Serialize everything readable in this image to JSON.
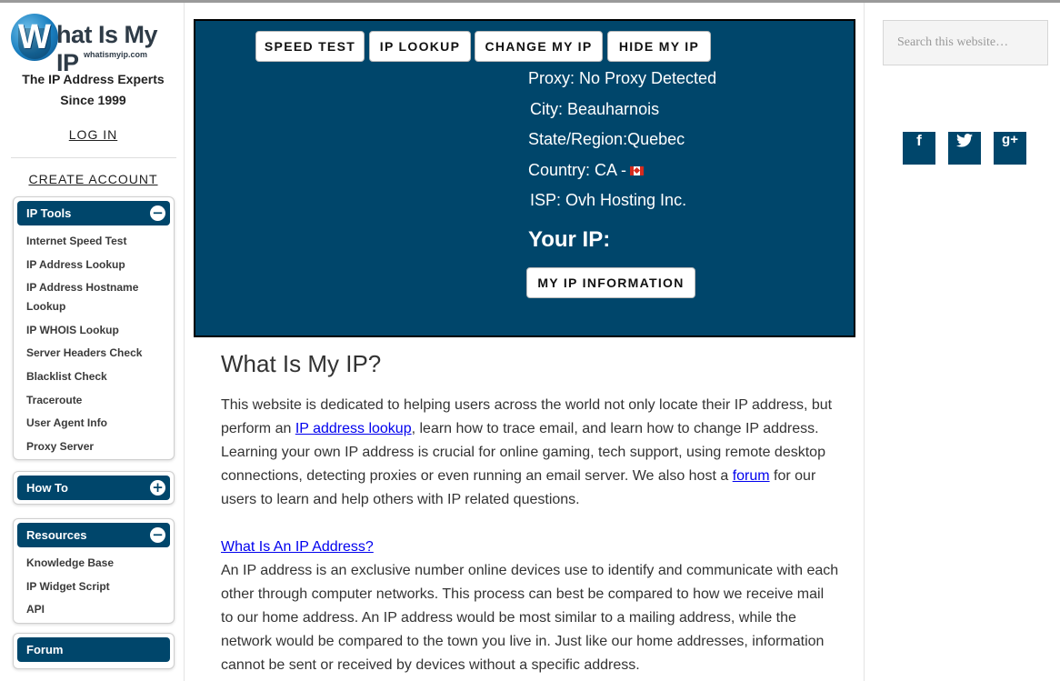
{
  "brand": {
    "logo_text": "hat Is My IP",
    "logo_letter": "W",
    "logo_domain": "whatismyip.com",
    "tagline_line1": "The IP Address Experts",
    "tagline_line2": "Since 1999"
  },
  "account": {
    "login_label": "LOG IN",
    "create_label": "CREATE ACCOUNT"
  },
  "sidebar": {
    "ip_tools": {
      "title": "IP Tools",
      "toggle": "−",
      "items": [
        "Internet Speed Test",
        "IP Address Lookup",
        "IP Address Hostname Lookup",
        "IP WHOIS Lookup",
        "Server Headers Check",
        "Blacklist Check",
        "Traceroute",
        "User Agent Info",
        "Proxy Server"
      ]
    },
    "how_to": {
      "title": "How To",
      "toggle": "+"
    },
    "resources": {
      "title": "Resources",
      "toggle": "−",
      "items": [
        "Knowledge Base",
        "IP Widget Script",
        "API"
      ]
    },
    "forum": {
      "title": "Forum"
    }
  },
  "hero": {
    "nav": [
      "SPEED TEST",
      "IP LOOKUP",
      "CHANGE MY IP",
      "HIDE MY IP"
    ],
    "proxy": "Proxy:  No Proxy Detected",
    "city": "City:  Beauharnois",
    "state": "State/Region:Quebec",
    "country": "Country: CA -",
    "isp": "ISP:  Ovh Hosting Inc.",
    "your_ip_label": "Your IP:",
    "my_ip_button": "MY IP INFORMATION"
  },
  "article": {
    "title": "What Is My IP?",
    "p1_a": "This website is dedicated to helping users across the world not only locate their IP address, but perform an ",
    "p1_link1": "IP address lookup",
    "p1_b": ", learn how to trace email, and learn how to change IP address. Learning your own IP address is crucial for online gaming, tech support, using remote desktop connections, detecting proxies or even running an email server. We also host a ",
    "p1_link2": "forum",
    "p1_c": " for our users to learn and help others with IP related questions.",
    "section_link": "What Is An IP Address?",
    "p2": "An IP address is an exclusive number online devices use to identify and communicate with each other through computer networks. This process can best be compared to how we receive mail to our home address. An IP address would be most similar to a mailing address, while the network would be compared to the town you live in. Just like our home addresses, information cannot be sent or received by devices without a specific address."
  },
  "right": {
    "search_placeholder": "Search this website…",
    "social": [
      "f",
      "t",
      "g+"
    ],
    "social_icons": [
      "facebook-icon",
      "twitter-icon",
      "google-plus-icon"
    ]
  },
  "colors": {
    "primary": "#00466b",
    "link": "#0000ee"
  }
}
